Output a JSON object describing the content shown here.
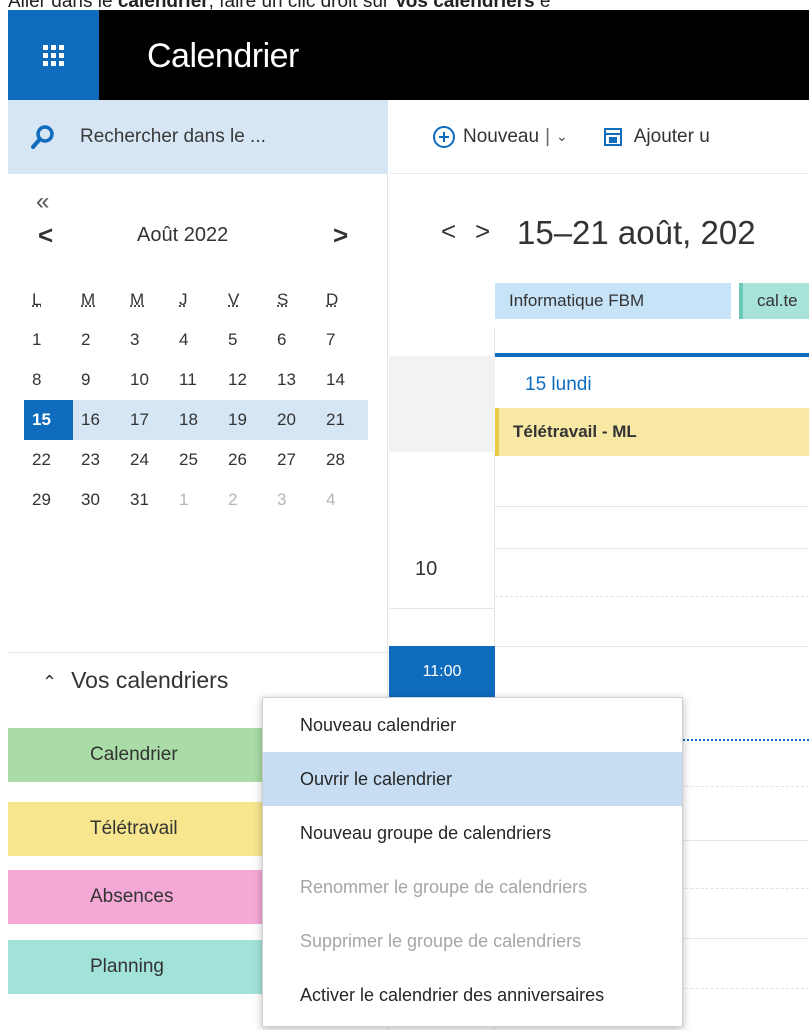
{
  "caption": {
    "prefix": "Aller dans le ",
    "bold1": "calendrier",
    "middle": ", faire un clic droit sur ",
    "bold2": "Vos calendriers",
    "suffix": " e"
  },
  "app": {
    "title": "Calendrier",
    "brand_color": "#0f6cbd"
  },
  "search": {
    "placeholder": "Rechercher dans le ..."
  },
  "toolbar": {
    "new_label": "Nouveau",
    "separator": "|",
    "add_label": "Ajouter u"
  },
  "mini_calendar": {
    "collapse_glyph": "«",
    "prev_glyph": "<",
    "next_glyph": ">",
    "month_label": "Août 2022",
    "weekdays": [
      "L",
      "M",
      "M",
      "J",
      "V",
      "S",
      "D"
    ],
    "weeks": [
      [
        "1",
        "2",
        "3",
        "4",
        "5",
        "6",
        "7"
      ],
      [
        "8",
        "9",
        "10",
        "11",
        "12",
        "13",
        "14"
      ],
      [
        "15",
        "16",
        "17",
        "18",
        "19",
        "20",
        "21"
      ],
      [
        "22",
        "23",
        "24",
        "25",
        "26",
        "27",
        "28"
      ],
      [
        "29",
        "30",
        "31",
        "1",
        "2",
        "3",
        "4"
      ]
    ],
    "selected_day": "15"
  },
  "your_calendars": {
    "label": "Vos calendriers",
    "items": [
      {
        "label": "Calendrier",
        "color": "#a9dca6"
      },
      {
        "label": "Télétravail",
        "color": "#f7e68d"
      },
      {
        "label": "Absences",
        "color": "#f4a8d6"
      },
      {
        "label": "Planning",
        "color": "#a2e3d9"
      }
    ]
  },
  "week_view": {
    "prev_glyph": "<",
    "next_glyph": ">",
    "title": "15–21 août, 202",
    "chips": [
      "Informatique FBM",
      "cal.te"
    ],
    "day_label": "15 lundi",
    "allday_event": "Télétravail - ML",
    "hour_10": "10",
    "now_time": "11:00"
  },
  "context_menu": {
    "items": [
      {
        "label": "Nouveau calendrier",
        "state": "normal"
      },
      {
        "label": "Ouvrir le calendrier",
        "state": "highlighted"
      },
      {
        "label": "Nouveau groupe de calendriers",
        "state": "normal"
      },
      {
        "label": "Renommer le groupe de calendriers",
        "state": "disabled"
      },
      {
        "label": "Supprimer le groupe de calendriers",
        "state": "disabled"
      },
      {
        "label": "Activer le calendrier des anniversaires",
        "state": "normal"
      }
    ]
  }
}
